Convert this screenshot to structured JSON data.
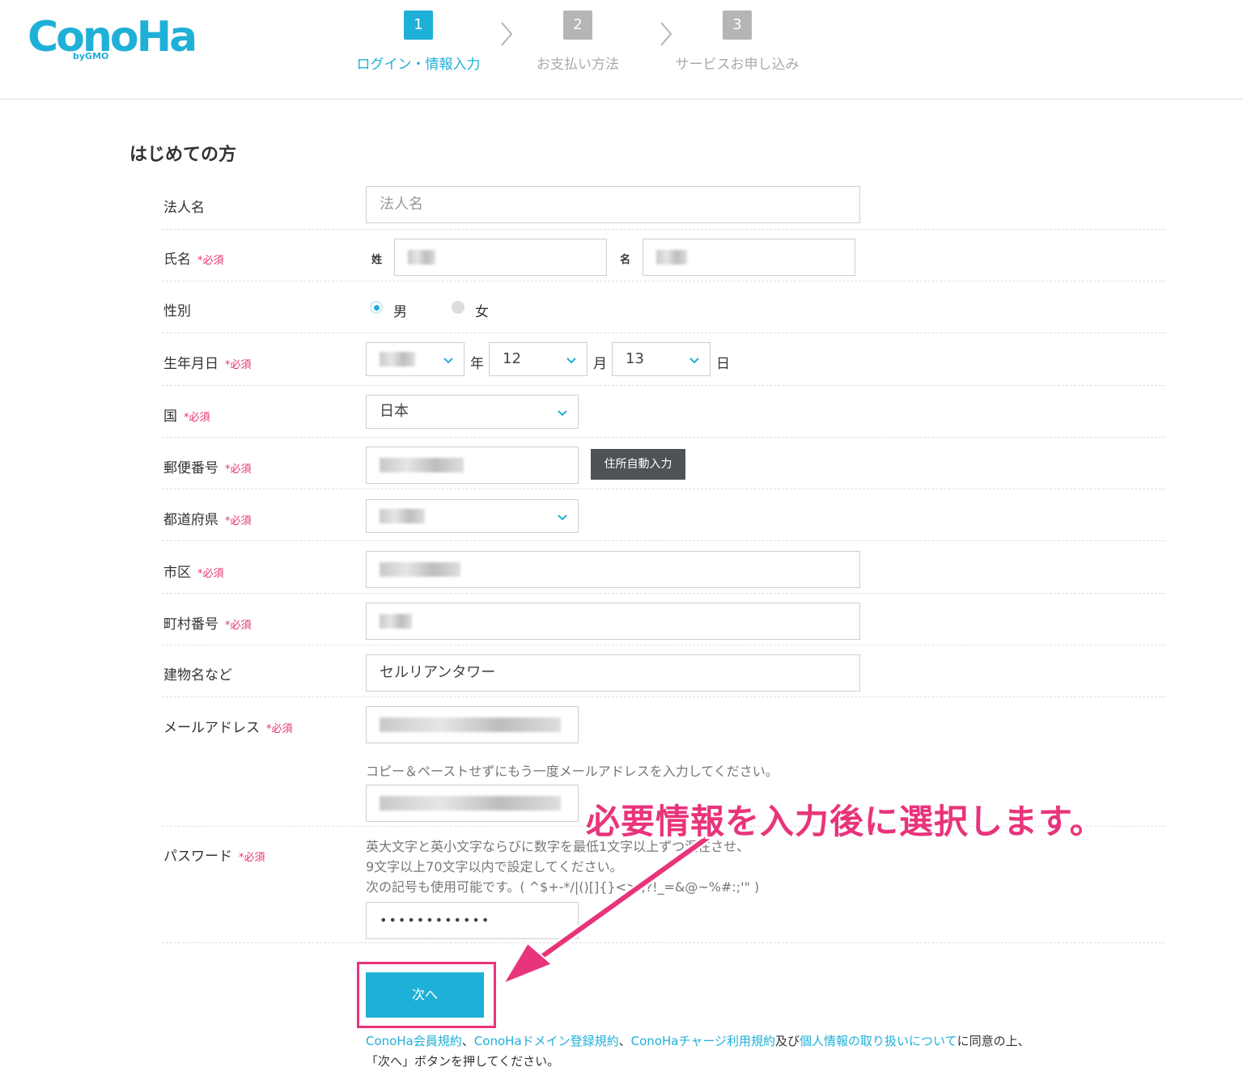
{
  "header": {
    "logo": "ConoHa",
    "logo_sub": "byGMO",
    "steps": [
      {
        "num": "1",
        "label": "ログイン・情報入力"
      },
      {
        "num": "2",
        "label": "お支払い方法"
      },
      {
        "num": "3",
        "label": "サービスお申し込み"
      }
    ]
  },
  "section_title": "はじめての方",
  "required_mark": "*必須",
  "form": {
    "company": {
      "label": "法人名",
      "placeholder": "法人名"
    },
    "name": {
      "label": "氏名",
      "last_label": "姓",
      "first_label": "名"
    },
    "gender": {
      "label": "性別",
      "options": [
        "男",
        "女"
      ],
      "selected": "男"
    },
    "birthday": {
      "label": "生年月日",
      "year_unit": "年",
      "month": "12",
      "month_unit": "月",
      "day": "13",
      "day_unit": "日"
    },
    "country": {
      "label": "国",
      "value": "日本"
    },
    "postal": {
      "label": "郵便番号",
      "autofill_button": "住所自動入力"
    },
    "prefecture": {
      "label": "都道府県"
    },
    "city": {
      "label": "市区"
    },
    "town": {
      "label": "町村番号"
    },
    "building": {
      "label": "建物名など",
      "value": "セルリアンタワー"
    },
    "email": {
      "label": "メールアドレス",
      "confirm_hint": "コピー＆ペーストせずにもう一度メールアドレスを入力してください。"
    },
    "password": {
      "label": "パスワード",
      "hint_lines": [
        "英大文字と英小文字ならびに数字を最低1文字以上ずつ混在させ、",
        "9文字以上70文字以内で設定してください。",
        "次の記号も使用可能です。( ^$+-*/|()[]{}<>.,?!_=&@~%#:;'\" )"
      ],
      "value": "••••••••••••"
    }
  },
  "next_button": "次へ",
  "terms": {
    "link1": "ConoHa会員規約",
    "sep1": "、",
    "link2": "ConoHaドメイン登録規約",
    "sep2": "、",
    "link3": "ConoHaチャージ利用規約",
    "and": "及び",
    "link4": "個人情報の取り扱いについて",
    "suffix": "に同意の上、",
    "line2": "「次へ」ボタンを押してください。"
  },
  "annotation": "必要情報を入力後に選択します。",
  "colors": {
    "accent": "#1fb0d8",
    "required": "#e5336e",
    "annotation": "#e8347a"
  }
}
